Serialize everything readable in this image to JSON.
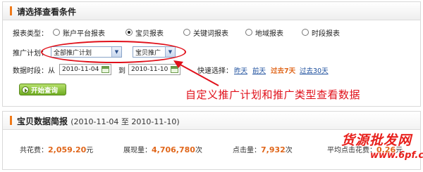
{
  "panel1": {
    "title": "请选择查看条件"
  },
  "report_type": {
    "label": "报表类型：",
    "options": [
      {
        "label": "账户平台报表",
        "selected": false
      },
      {
        "label": "宝贝报表",
        "selected": true
      },
      {
        "label": "关键词报表",
        "selected": false
      },
      {
        "label": "地域报表",
        "selected": false
      },
      {
        "label": "时段报表",
        "selected": false
      }
    ]
  },
  "plan": {
    "label": "推广计划：",
    "plan_select": "全部推广计划",
    "type_select": "宝贝推广"
  },
  "date": {
    "label": "数据时段：从",
    "from": "2010-11-04",
    "to_label": "到",
    "to": "2010-11-10",
    "quick_label": "快速选择：",
    "quick": [
      {
        "label": "昨天",
        "active": false
      },
      {
        "label": "前天",
        "active": false
      },
      {
        "label": "过去7天",
        "active": true
      },
      {
        "label": "过去30天",
        "active": false
      }
    ]
  },
  "query_button": "开始查询",
  "annotation": "自定义推广计划和推广类型查看数据",
  "panel2": {
    "title": "宝贝数据简报",
    "range": "(2010-11-04 至 2010-11-10)"
  },
  "stats": [
    {
      "label": "共花费：",
      "value": "2,059.20",
      "unit": "元"
    },
    {
      "label": "展现量：",
      "value": "4,706,780",
      "unit": "次"
    },
    {
      "label": "点击量：",
      "value": "7,932",
      "unit": "次"
    },
    {
      "label": "平均点击花费：",
      "value": "0.26",
      "unit": "元"
    }
  ],
  "watermark": {
    "text": "货源批发网",
    "url": "www.6pf.cn"
  },
  "colors": {
    "accent": "#e0661a",
    "annotation": "#e0101a",
    "link": "#1a4d9c",
    "button": "#6fac22"
  }
}
